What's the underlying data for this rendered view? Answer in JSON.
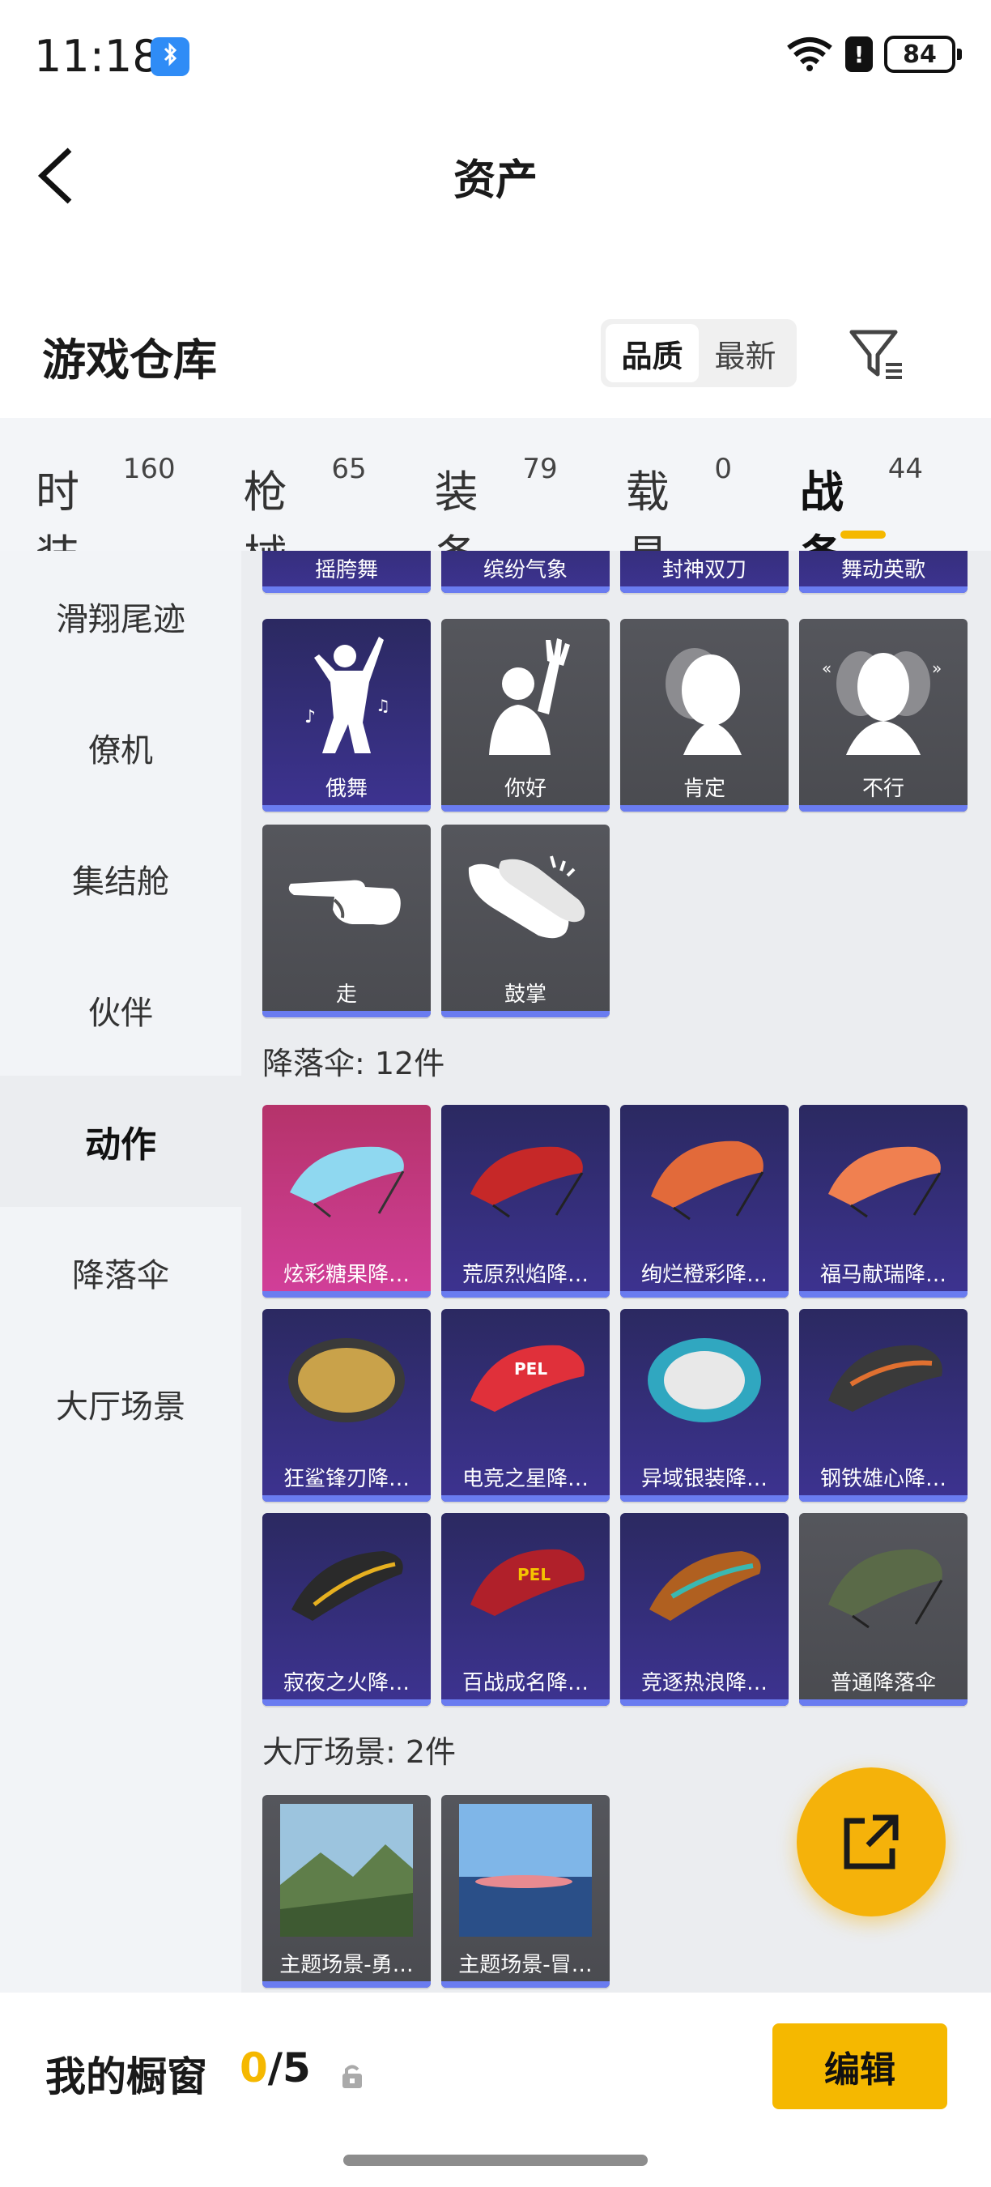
{
  "status": {
    "time": "11:18",
    "battery": "84"
  },
  "nav": {
    "title": "资产"
  },
  "header": {
    "title": "游戏仓库",
    "sort_quality": "品质",
    "sort_latest": "最新"
  },
  "tabs": [
    {
      "label": "时装",
      "count": "160"
    },
    {
      "label": "枪械",
      "count": "65"
    },
    {
      "label": "装备",
      "count": "79"
    },
    {
      "label": "载具",
      "count": "0"
    },
    {
      "label": "战备",
      "count": "44"
    }
  ],
  "sidebar": [
    {
      "label": "滑翔尾迹"
    },
    {
      "label": "僚机"
    },
    {
      "label": "集结舱"
    },
    {
      "label": "伙伴"
    },
    {
      "label": "动作"
    },
    {
      "label": "降落伞"
    },
    {
      "label": "大厅场景"
    }
  ],
  "actions_partial": [
    {
      "name": "摇胯舞"
    },
    {
      "name": "缤纷气象"
    },
    {
      "name": "封神双刀"
    },
    {
      "name": "舞动英歌"
    }
  ],
  "actions": [
    {
      "name": "俄舞"
    },
    {
      "name": "你好"
    },
    {
      "name": "肯定"
    },
    {
      "name": "不行"
    },
    {
      "name": "走"
    },
    {
      "name": "鼓掌"
    }
  ],
  "parachute_group": {
    "label": "降落伞: 12件"
  },
  "parachutes": [
    {
      "name": "炫彩糖果降…"
    },
    {
      "name": "荒原烈焰降…"
    },
    {
      "name": "绚烂橙彩降…"
    },
    {
      "name": "福马献瑞降…"
    },
    {
      "name": "狂鲨锋刃降…"
    },
    {
      "name": "电竞之星降…"
    },
    {
      "name": "异域银装降…"
    },
    {
      "name": "钢铁雄心降…"
    },
    {
      "name": "寂夜之火降…"
    },
    {
      "name": "百战成名降…"
    },
    {
      "name": "竞逐热浪降…"
    },
    {
      "name": "普通降落伞"
    }
  ],
  "scene_group": {
    "label": "大厅场景: 2件"
  },
  "scenes": [
    {
      "name": "主题场景-勇…"
    },
    {
      "name": "主题场景-冒…"
    }
  ],
  "showcase": {
    "label": "我的橱窗",
    "current": "0",
    "total": "/5",
    "edit": "编辑"
  },
  "colors": {
    "accent": "#f5b800",
    "fab": "#f5b20a",
    "tile_bar": "#6a7cf0"
  }
}
